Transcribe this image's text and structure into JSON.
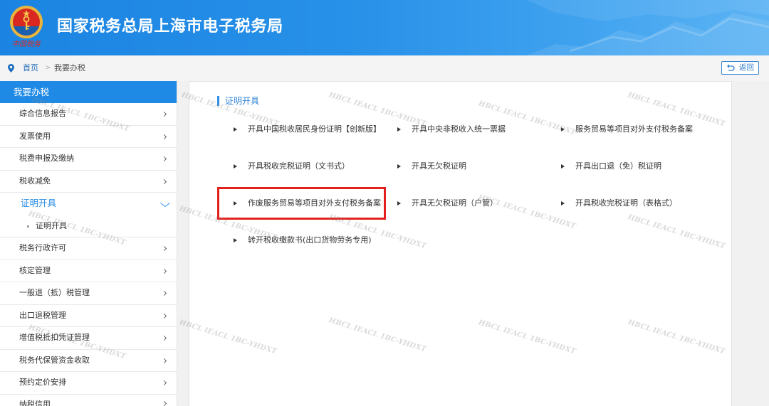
{
  "header": {
    "title": "国家税务总局上海市电子税务局",
    "logo_caption": "中国税务",
    "logo_icon": "tax-emblem-icon"
  },
  "breadcrumb": {
    "icon": "location-pin-icon",
    "home": "首页",
    "separator": ">",
    "current": "我要办税"
  },
  "back_button": {
    "label": "返回",
    "icon": "return-arrow-icon"
  },
  "sidebar": {
    "title": "我要办税",
    "item_icon": "chevron-right-icon",
    "expanded_icon": "chevron-down-icon",
    "child_icon": "dot-icon",
    "items": [
      {
        "label": "综合信息报告"
      },
      {
        "label": "发票使用"
      },
      {
        "label": "税费申报及缴纳"
      },
      {
        "label": "税收减免"
      },
      {
        "label": "证明开具",
        "active": true,
        "expanded": true,
        "children": [
          {
            "label": "证明开具"
          }
        ]
      },
      {
        "label": "税务行政许可"
      },
      {
        "label": "核定管理"
      },
      {
        "label": "一般退（抵）税管理"
      },
      {
        "label": "出口退税管理"
      },
      {
        "label": "增值税抵扣凭证管理"
      },
      {
        "label": "税务代保管资金收取"
      },
      {
        "label": "预约定价安排"
      },
      {
        "label": "纳税信用"
      }
    ]
  },
  "main": {
    "section_title": "证明开具",
    "bullet_icon": "triangle-right-icon",
    "services": [
      {
        "label": "开具中国税收居民身份证明【创新版】"
      },
      {
        "label": "开具中央非税收入统一票据"
      },
      {
        "label": "服务贸易等项目对外支付税务备案"
      },
      {
        "label": "开具税收完税证明（文书式）"
      },
      {
        "label": "开具无欠税证明"
      },
      {
        "label": "开具出口退（免）税证明"
      },
      {
        "label": "作废服务贸易等项目对外支付税务备案",
        "highlighted": true
      },
      {
        "label": "开具无欠税证明（户管）"
      },
      {
        "label": "开具税收完税证明（表格式）"
      },
      {
        "label": "转开税收缴款书(出口货物劳务专用)"
      }
    ]
  },
  "watermark": {
    "text": "HBCL IEACL 1BC-YHDXT"
  },
  "colors": {
    "header_blue": "#1f88e5",
    "accent_blue": "#2d8ee6",
    "highlight_red": "#e3211c",
    "text": "#333333",
    "page_background": "#f1f1f1"
  }
}
